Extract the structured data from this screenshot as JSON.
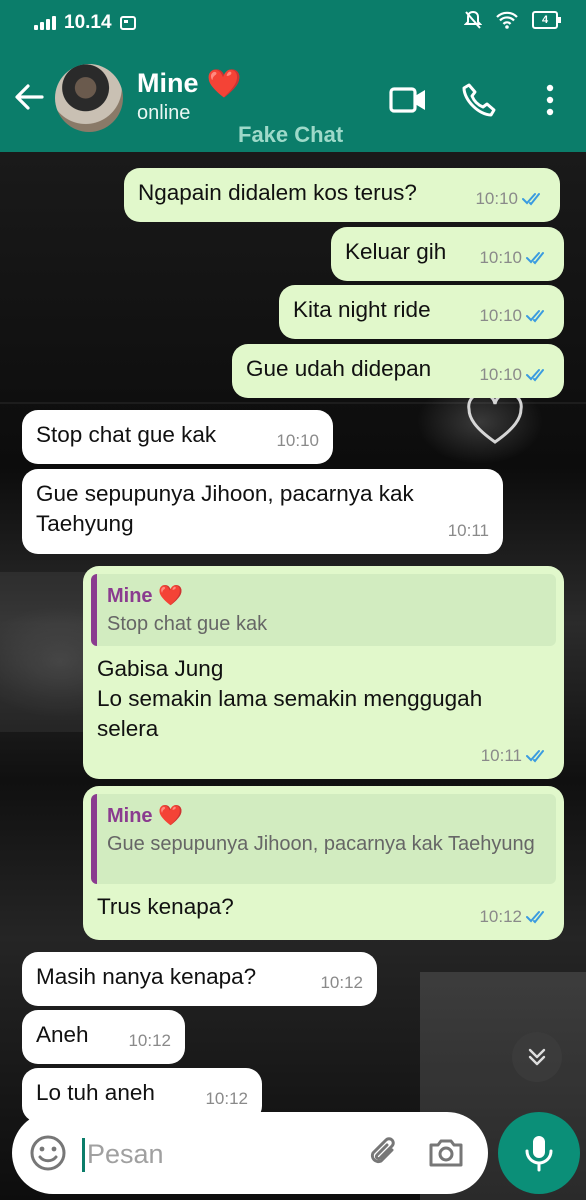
{
  "status_bar": {
    "time": "10.14",
    "battery": "4"
  },
  "header": {
    "contact_name": "Mine",
    "contact_emoji": "❤️",
    "contact_status": "online",
    "watermark": "Fake Chat",
    "icons": [
      "back-arrow-icon",
      "video-call-icon",
      "voice-call-icon",
      "more-options-icon"
    ]
  },
  "colors": {
    "header": "#0b7d6a",
    "outgoing_bubble": "#e1f8cb",
    "incoming_bubble": "#ffffff",
    "quote_accent": "#8a3b8f",
    "read_ticks": "#3a9be0",
    "mic_button": "#0b8f78"
  },
  "messages": [
    {
      "direction": "out",
      "text": "Ngapain didalem kos terus?",
      "time": "10:10",
      "read": true
    },
    {
      "direction": "out",
      "text": "Keluar gih",
      "time": "10:10",
      "read": true
    },
    {
      "direction": "out",
      "text": "Kita night ride",
      "time": "10:10",
      "read": true
    },
    {
      "direction": "out",
      "text": "Gue udah didepan",
      "time": "10:10",
      "read": true
    },
    {
      "direction": "in",
      "text": "Stop chat gue kak",
      "time": "10:10"
    },
    {
      "direction": "in",
      "line1": "Gue sepupunya Jihoon, pacarnya kak",
      "line2": "Taehyung",
      "time": "10:11"
    },
    {
      "direction": "out",
      "quote_name": "Mine ❤️",
      "quote_text": "Stop chat gue kak",
      "line1": "Gabisa Jung",
      "line2": "Lo semakin lama semakin menggugah",
      "line3": "selera",
      "time": "10:11",
      "read": true
    },
    {
      "direction": "out",
      "quote_name": "Mine ❤️",
      "quote_text": "Gue sepupunya Jihoon, pacarnya kak Taehyung",
      "text": "Trus kenapa?",
      "time": "10:12",
      "read": true
    },
    {
      "direction": "in",
      "text": "Masih nanya kenapa?",
      "time": "10:12"
    },
    {
      "direction": "in",
      "text": "Aneh",
      "time": "10:12"
    },
    {
      "direction": "in",
      "text": "Lo tuh aneh",
      "time": "10:12"
    }
  ],
  "composer": {
    "placeholder": "Pesan"
  }
}
